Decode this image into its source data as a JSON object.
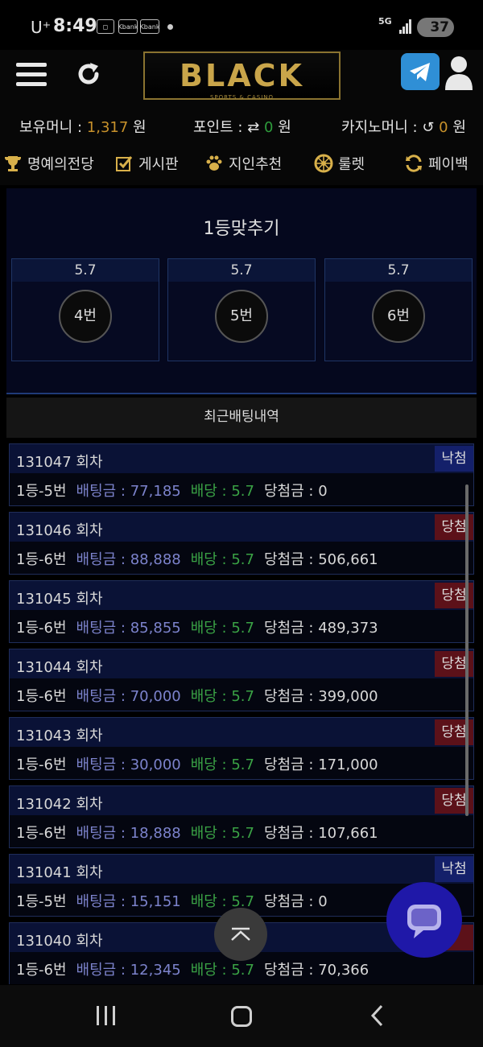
{
  "status_bar": {
    "carrier": "U⁺",
    "time": "8:49",
    "notif_icon_1": "Kbank",
    "notif_icon_2": "Kbank",
    "network": "5G",
    "battery": "37"
  },
  "header": {
    "logo": "BLACK",
    "logo_sub": "SPORTS & CASINO"
  },
  "balances": {
    "money_label": "보유머니 :",
    "money_value": "1,317",
    "money_unit": "원",
    "point_label": "포인트 :",
    "point_value": "0",
    "point_unit": "원",
    "casino_label": "카지노머니 :",
    "casino_value": "0",
    "casino_unit": "원"
  },
  "menu": [
    {
      "label": "명예의전당",
      "icon": "trophy-icon"
    },
    {
      "label": "게시판",
      "icon": "checkbox-icon"
    },
    {
      "label": "지인추천",
      "icon": "paw-icon"
    },
    {
      "label": "룰렛",
      "icon": "roulette-icon"
    },
    {
      "label": "페이백",
      "icon": "sync-icon"
    }
  ],
  "game": {
    "title": "1등맞추기",
    "options": [
      {
        "odds": "5.7",
        "label": "4번"
      },
      {
        "odds": "5.7",
        "label": "5번"
      },
      {
        "odds": "5.7",
        "label": "6번"
      }
    ]
  },
  "recent_title": "최근배팅내역",
  "labels": {
    "bet": "배팅금 :",
    "odds": "배당 :",
    "payout": "당첨금 :"
  },
  "bets": [
    {
      "round": "131047 회차",
      "status": "낙첨",
      "result": "lose",
      "pick": "1등-5번",
      "amount": "77,185",
      "odds": "5.7",
      "payout": "0"
    },
    {
      "round": "131046 회차",
      "status": "당첨",
      "result": "win",
      "pick": "1등-6번",
      "amount": "88,888",
      "odds": "5.7",
      "payout": "506,661"
    },
    {
      "round": "131045 회차",
      "status": "당첨",
      "result": "win",
      "pick": "1등-6번",
      "amount": "85,855",
      "odds": "5.7",
      "payout": "489,373"
    },
    {
      "round": "131044 회차",
      "status": "당첨",
      "result": "win",
      "pick": "1등-6번",
      "amount": "70,000",
      "odds": "5.7",
      "payout": "399,000"
    },
    {
      "round": "131043 회차",
      "status": "당첨",
      "result": "win",
      "pick": "1등-6번",
      "amount": "30,000",
      "odds": "5.7",
      "payout": "171,000"
    },
    {
      "round": "131042 회차",
      "status": "당첨",
      "result": "win",
      "pick": "1등-6번",
      "amount": "18,888",
      "odds": "5.7",
      "payout": "107,661"
    },
    {
      "round": "131041 회차",
      "status": "낙첨",
      "result": "lose",
      "pick": "1등-5번",
      "amount": "15,151",
      "odds": "5.7",
      "payout": "0"
    },
    {
      "round": "131040 회차",
      "status": "",
      "result": "win",
      "pick": "1등-6번",
      "amount": "12,345",
      "odds": "5.7",
      "payout": "70,366"
    }
  ],
  "colors": {
    "gold": "#c9a54a",
    "money": "#c7912b",
    "green": "#3aa245",
    "bet_blue": "#7c83cc",
    "lose_badge": "#14206a",
    "win_badge": "#5c1119",
    "chat_button": "#1f18a8"
  }
}
